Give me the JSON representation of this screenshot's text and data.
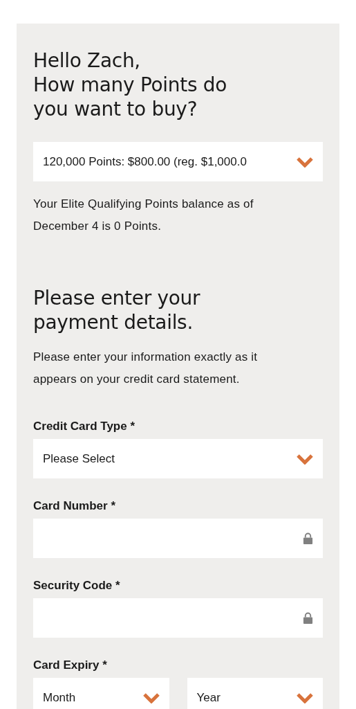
{
  "heading": [
    "Hello Zach,",
    "How many Points do",
    "you want to buy?"
  ],
  "points_select": {
    "value": "120,000 Points: $800.00 (reg. $1,000.0"
  },
  "balance_note": "Your Elite Qualifying Points balance as of December 4 is 0 Points.",
  "payment_heading": [
    "Please enter your",
    "payment details."
  ],
  "payment_note": "Please enter your information exactly as it appears on your credit card statement.",
  "fields": [
    {
      "label": "Credit Card Type *",
      "kind": "select",
      "controls": [
        {
          "value": "Please Select"
        }
      ]
    },
    {
      "label": "Card Number *",
      "kind": "secure"
    },
    {
      "label": "Security Code *",
      "kind": "secure"
    },
    {
      "label": "Card Expiry *",
      "kind": "select",
      "controls": [
        {
          "value": "Month"
        },
        {
          "value": "Year"
        }
      ]
    }
  ]
}
